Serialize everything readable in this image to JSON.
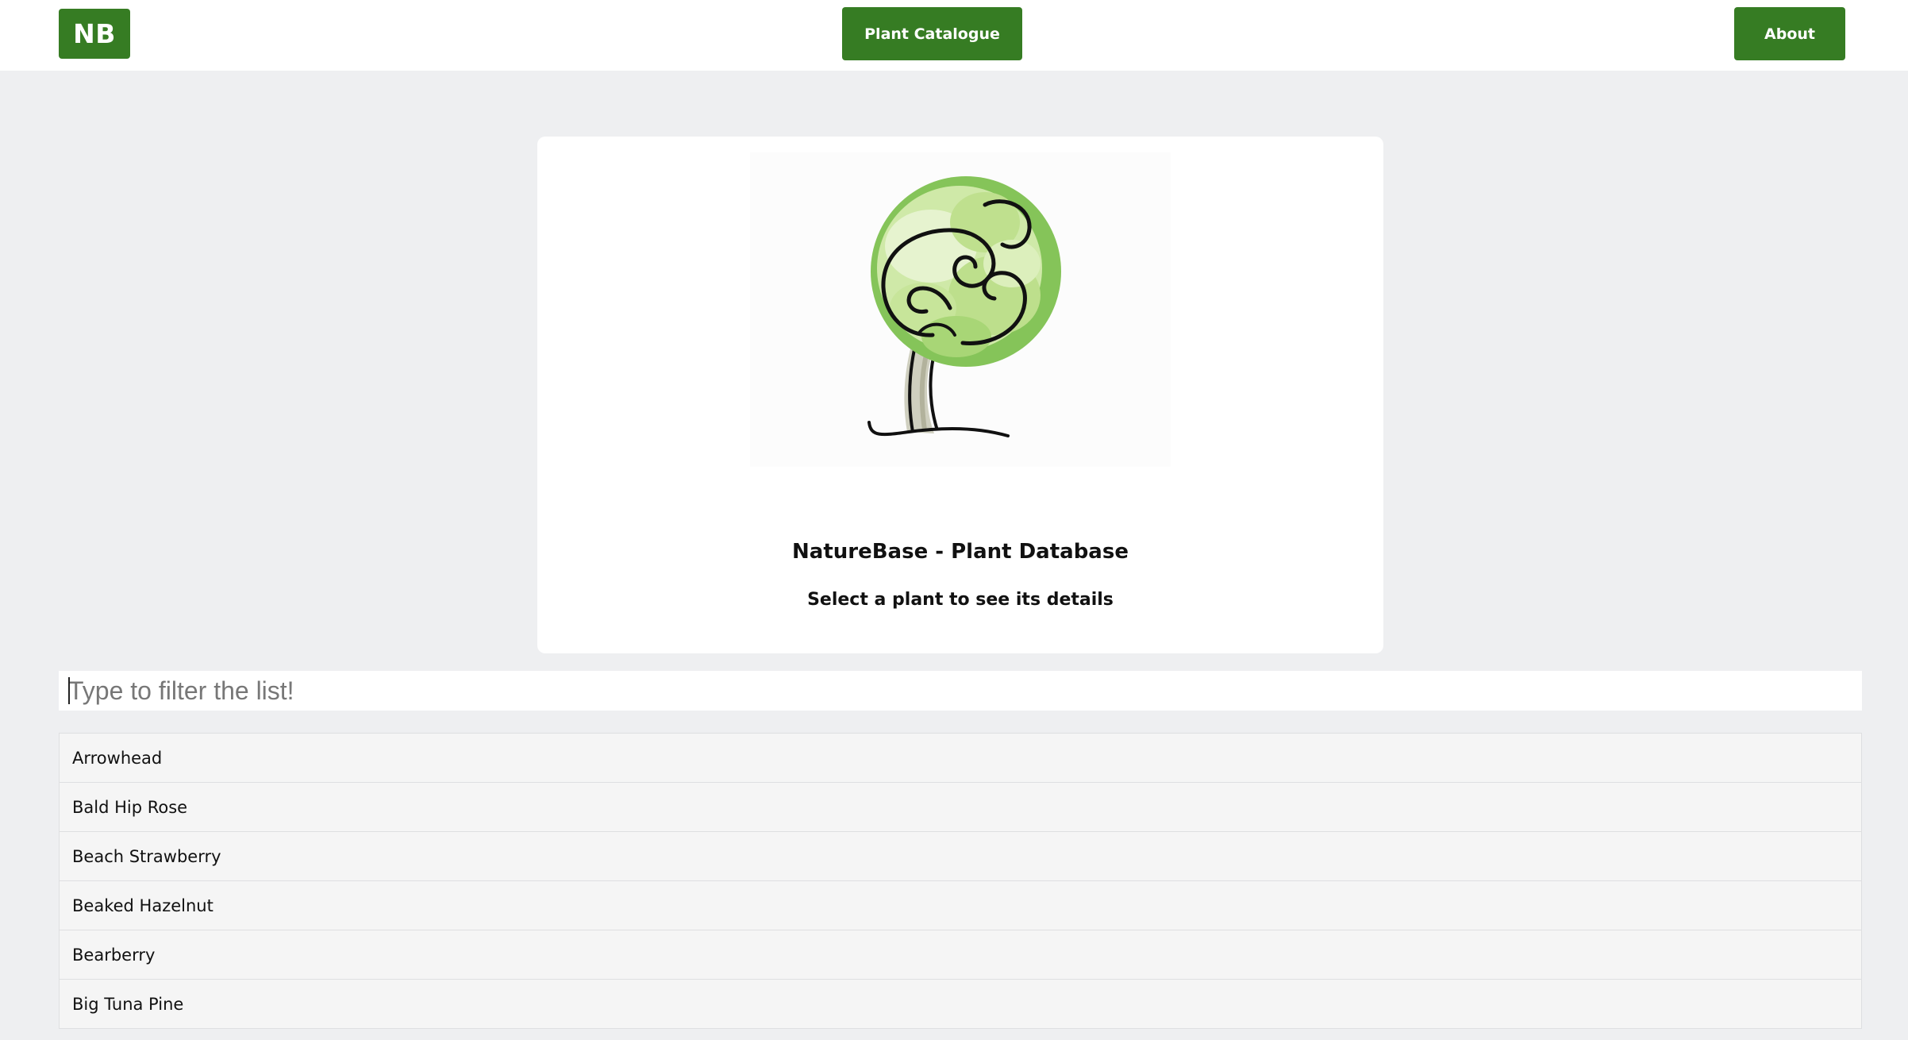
{
  "header": {
    "logo_label": "NB",
    "nav": [
      {
        "label": "Plant Catalogue"
      },
      {
        "label": "About"
      }
    ]
  },
  "hero": {
    "image_icon": "tree-illustration",
    "title": "NatureBase - Plant Database",
    "subtitle": "Select a plant to see its details"
  },
  "filter": {
    "value": "",
    "placeholder": "Type to filter the list!"
  },
  "plants": [
    {
      "name": "Arrowhead"
    },
    {
      "name": "Bald Hip Rose"
    },
    {
      "name": "Beach Strawberry"
    },
    {
      "name": "Beaked Hazelnut"
    },
    {
      "name": "Bearberry"
    },
    {
      "name": "Big Tuna Pine"
    }
  ],
  "colors": {
    "brand_green": "#367c23",
    "page_background": "#eeeff1",
    "list_item_background": "#f5f5f5"
  }
}
